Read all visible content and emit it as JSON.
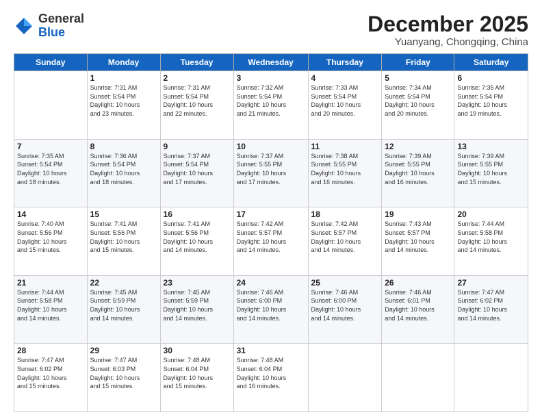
{
  "header": {
    "logo_general": "General",
    "logo_blue": "Blue",
    "month_title": "December 2025",
    "location": "Yuanyang, Chongqing, China"
  },
  "weekdays": [
    "Sunday",
    "Monday",
    "Tuesday",
    "Wednesday",
    "Thursday",
    "Friday",
    "Saturday"
  ],
  "weeks": [
    [
      {
        "day": "",
        "info": ""
      },
      {
        "day": "1",
        "info": "Sunrise: 7:31 AM\nSunset: 5:54 PM\nDaylight: 10 hours\nand 23 minutes."
      },
      {
        "day": "2",
        "info": "Sunrise: 7:31 AM\nSunset: 5:54 PM\nDaylight: 10 hours\nand 22 minutes."
      },
      {
        "day": "3",
        "info": "Sunrise: 7:32 AM\nSunset: 5:54 PM\nDaylight: 10 hours\nand 21 minutes."
      },
      {
        "day": "4",
        "info": "Sunrise: 7:33 AM\nSunset: 5:54 PM\nDaylight: 10 hours\nand 20 minutes."
      },
      {
        "day": "5",
        "info": "Sunrise: 7:34 AM\nSunset: 5:54 PM\nDaylight: 10 hours\nand 20 minutes."
      },
      {
        "day": "6",
        "info": "Sunrise: 7:35 AM\nSunset: 5:54 PM\nDaylight: 10 hours\nand 19 minutes."
      }
    ],
    [
      {
        "day": "7",
        "info": "Sunrise: 7:35 AM\nSunset: 5:54 PM\nDaylight: 10 hours\nand 18 minutes."
      },
      {
        "day": "8",
        "info": "Sunrise: 7:36 AM\nSunset: 5:54 PM\nDaylight: 10 hours\nand 18 minutes."
      },
      {
        "day": "9",
        "info": "Sunrise: 7:37 AM\nSunset: 5:54 PM\nDaylight: 10 hours\nand 17 minutes."
      },
      {
        "day": "10",
        "info": "Sunrise: 7:37 AM\nSunset: 5:55 PM\nDaylight: 10 hours\nand 17 minutes."
      },
      {
        "day": "11",
        "info": "Sunrise: 7:38 AM\nSunset: 5:55 PM\nDaylight: 10 hours\nand 16 minutes."
      },
      {
        "day": "12",
        "info": "Sunrise: 7:39 AM\nSunset: 5:55 PM\nDaylight: 10 hours\nand 16 minutes."
      },
      {
        "day": "13",
        "info": "Sunrise: 7:39 AM\nSunset: 5:55 PM\nDaylight: 10 hours\nand 15 minutes."
      }
    ],
    [
      {
        "day": "14",
        "info": "Sunrise: 7:40 AM\nSunset: 5:56 PM\nDaylight: 10 hours\nand 15 minutes."
      },
      {
        "day": "15",
        "info": "Sunrise: 7:41 AM\nSunset: 5:56 PM\nDaylight: 10 hours\nand 15 minutes."
      },
      {
        "day": "16",
        "info": "Sunrise: 7:41 AM\nSunset: 5:56 PM\nDaylight: 10 hours\nand 14 minutes."
      },
      {
        "day": "17",
        "info": "Sunrise: 7:42 AM\nSunset: 5:57 PM\nDaylight: 10 hours\nand 14 minutes."
      },
      {
        "day": "18",
        "info": "Sunrise: 7:42 AM\nSunset: 5:57 PM\nDaylight: 10 hours\nand 14 minutes."
      },
      {
        "day": "19",
        "info": "Sunrise: 7:43 AM\nSunset: 5:57 PM\nDaylight: 10 hours\nand 14 minutes."
      },
      {
        "day": "20",
        "info": "Sunrise: 7:44 AM\nSunset: 5:58 PM\nDaylight: 10 hours\nand 14 minutes."
      }
    ],
    [
      {
        "day": "21",
        "info": "Sunrise: 7:44 AM\nSunset: 5:58 PM\nDaylight: 10 hours\nand 14 minutes."
      },
      {
        "day": "22",
        "info": "Sunrise: 7:45 AM\nSunset: 5:59 PM\nDaylight: 10 hours\nand 14 minutes."
      },
      {
        "day": "23",
        "info": "Sunrise: 7:45 AM\nSunset: 5:59 PM\nDaylight: 10 hours\nand 14 minutes."
      },
      {
        "day": "24",
        "info": "Sunrise: 7:46 AM\nSunset: 6:00 PM\nDaylight: 10 hours\nand 14 minutes."
      },
      {
        "day": "25",
        "info": "Sunrise: 7:46 AM\nSunset: 6:00 PM\nDaylight: 10 hours\nand 14 minutes."
      },
      {
        "day": "26",
        "info": "Sunrise: 7:46 AM\nSunset: 6:01 PM\nDaylight: 10 hours\nand 14 minutes."
      },
      {
        "day": "27",
        "info": "Sunrise: 7:47 AM\nSunset: 6:02 PM\nDaylight: 10 hours\nand 14 minutes."
      }
    ],
    [
      {
        "day": "28",
        "info": "Sunrise: 7:47 AM\nSunset: 6:02 PM\nDaylight: 10 hours\nand 15 minutes."
      },
      {
        "day": "29",
        "info": "Sunrise: 7:47 AM\nSunset: 6:03 PM\nDaylight: 10 hours\nand 15 minutes."
      },
      {
        "day": "30",
        "info": "Sunrise: 7:48 AM\nSunset: 6:04 PM\nDaylight: 10 hours\nand 15 minutes."
      },
      {
        "day": "31",
        "info": "Sunrise: 7:48 AM\nSunset: 6:04 PM\nDaylight: 10 hours\nand 16 minutes."
      },
      {
        "day": "",
        "info": ""
      },
      {
        "day": "",
        "info": ""
      },
      {
        "day": "",
        "info": ""
      }
    ]
  ]
}
